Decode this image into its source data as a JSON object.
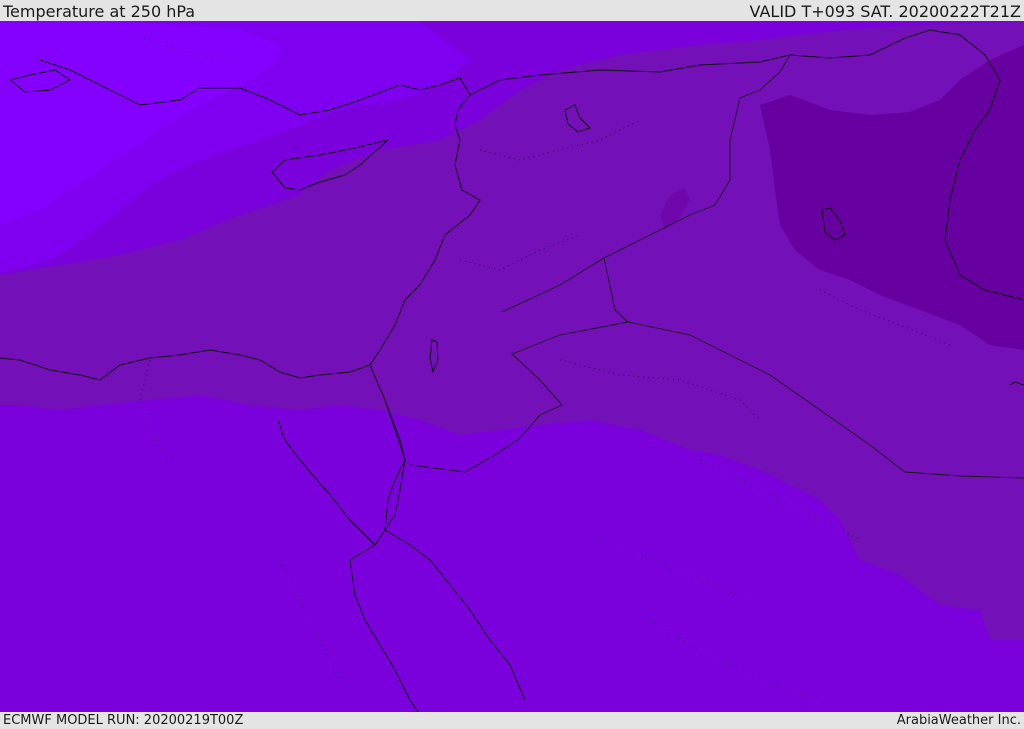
{
  "header": {
    "title": "Temperature at 250 hPa",
    "valid_time": "VALID T+093 SAT. 20200222T21Z"
  },
  "footer": {
    "model_run": "ECMWF MODEL RUN: 20200219T00Z",
    "credit": "ArabiaWeather Inc."
  },
  "map": {
    "field": "temperature",
    "level": "250 hPa",
    "colors": {
      "base": "#7a00dc",
      "cold_band": "#7f00f0",
      "coldest": "#8400ff",
      "warm_band": "#7410b8",
      "warmest": "#6600a0",
      "coastline": "#111111"
    }
  }
}
